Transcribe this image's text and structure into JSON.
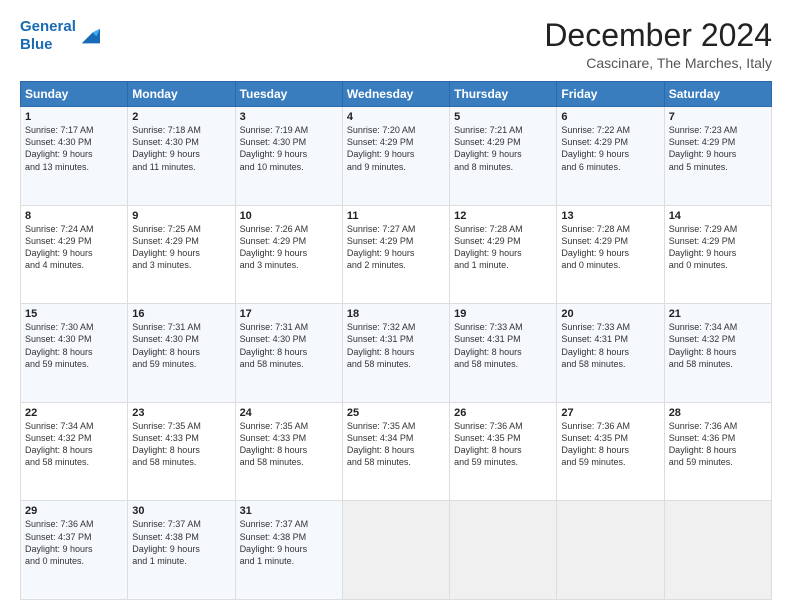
{
  "header": {
    "logo_line1": "General",
    "logo_line2": "Blue",
    "month": "December 2024",
    "location": "Cascinare, The Marches, Italy"
  },
  "days_of_week": [
    "Sunday",
    "Monday",
    "Tuesday",
    "Wednesday",
    "Thursday",
    "Friday",
    "Saturday"
  ],
  "weeks": [
    [
      {
        "day": "1",
        "lines": [
          "Sunrise: 7:17 AM",
          "Sunset: 4:30 PM",
          "Daylight: 9 hours",
          "and 13 minutes."
        ]
      },
      {
        "day": "2",
        "lines": [
          "Sunrise: 7:18 AM",
          "Sunset: 4:30 PM",
          "Daylight: 9 hours",
          "and 11 minutes."
        ]
      },
      {
        "day": "3",
        "lines": [
          "Sunrise: 7:19 AM",
          "Sunset: 4:30 PM",
          "Daylight: 9 hours",
          "and 10 minutes."
        ]
      },
      {
        "day": "4",
        "lines": [
          "Sunrise: 7:20 AM",
          "Sunset: 4:29 PM",
          "Daylight: 9 hours",
          "and 9 minutes."
        ]
      },
      {
        "day": "5",
        "lines": [
          "Sunrise: 7:21 AM",
          "Sunset: 4:29 PM",
          "Daylight: 9 hours",
          "and 8 minutes."
        ]
      },
      {
        "day": "6",
        "lines": [
          "Sunrise: 7:22 AM",
          "Sunset: 4:29 PM",
          "Daylight: 9 hours",
          "and 6 minutes."
        ]
      },
      {
        "day": "7",
        "lines": [
          "Sunrise: 7:23 AM",
          "Sunset: 4:29 PM",
          "Daylight: 9 hours",
          "and 5 minutes."
        ]
      }
    ],
    [
      {
        "day": "8",
        "lines": [
          "Sunrise: 7:24 AM",
          "Sunset: 4:29 PM",
          "Daylight: 9 hours",
          "and 4 minutes."
        ]
      },
      {
        "day": "9",
        "lines": [
          "Sunrise: 7:25 AM",
          "Sunset: 4:29 PM",
          "Daylight: 9 hours",
          "and 3 minutes."
        ]
      },
      {
        "day": "10",
        "lines": [
          "Sunrise: 7:26 AM",
          "Sunset: 4:29 PM",
          "Daylight: 9 hours",
          "and 3 minutes."
        ]
      },
      {
        "day": "11",
        "lines": [
          "Sunrise: 7:27 AM",
          "Sunset: 4:29 PM",
          "Daylight: 9 hours",
          "and 2 minutes."
        ]
      },
      {
        "day": "12",
        "lines": [
          "Sunrise: 7:28 AM",
          "Sunset: 4:29 PM",
          "Daylight: 9 hours",
          "and 1 minute."
        ]
      },
      {
        "day": "13",
        "lines": [
          "Sunrise: 7:28 AM",
          "Sunset: 4:29 PM",
          "Daylight: 9 hours",
          "and 0 minutes."
        ]
      },
      {
        "day": "14",
        "lines": [
          "Sunrise: 7:29 AM",
          "Sunset: 4:29 PM",
          "Daylight: 9 hours",
          "and 0 minutes."
        ]
      }
    ],
    [
      {
        "day": "15",
        "lines": [
          "Sunrise: 7:30 AM",
          "Sunset: 4:30 PM",
          "Daylight: 8 hours",
          "and 59 minutes."
        ]
      },
      {
        "day": "16",
        "lines": [
          "Sunrise: 7:31 AM",
          "Sunset: 4:30 PM",
          "Daylight: 8 hours",
          "and 59 minutes."
        ]
      },
      {
        "day": "17",
        "lines": [
          "Sunrise: 7:31 AM",
          "Sunset: 4:30 PM",
          "Daylight: 8 hours",
          "and 58 minutes."
        ]
      },
      {
        "day": "18",
        "lines": [
          "Sunrise: 7:32 AM",
          "Sunset: 4:31 PM",
          "Daylight: 8 hours",
          "and 58 minutes."
        ]
      },
      {
        "day": "19",
        "lines": [
          "Sunrise: 7:33 AM",
          "Sunset: 4:31 PM",
          "Daylight: 8 hours",
          "and 58 minutes."
        ]
      },
      {
        "day": "20",
        "lines": [
          "Sunrise: 7:33 AM",
          "Sunset: 4:31 PM",
          "Daylight: 8 hours",
          "and 58 minutes."
        ]
      },
      {
        "day": "21",
        "lines": [
          "Sunrise: 7:34 AM",
          "Sunset: 4:32 PM",
          "Daylight: 8 hours",
          "and 58 minutes."
        ]
      }
    ],
    [
      {
        "day": "22",
        "lines": [
          "Sunrise: 7:34 AM",
          "Sunset: 4:32 PM",
          "Daylight: 8 hours",
          "and 58 minutes."
        ]
      },
      {
        "day": "23",
        "lines": [
          "Sunrise: 7:35 AM",
          "Sunset: 4:33 PM",
          "Daylight: 8 hours",
          "and 58 minutes."
        ]
      },
      {
        "day": "24",
        "lines": [
          "Sunrise: 7:35 AM",
          "Sunset: 4:33 PM",
          "Daylight: 8 hours",
          "and 58 minutes."
        ]
      },
      {
        "day": "25",
        "lines": [
          "Sunrise: 7:35 AM",
          "Sunset: 4:34 PM",
          "Daylight: 8 hours",
          "and 58 minutes."
        ]
      },
      {
        "day": "26",
        "lines": [
          "Sunrise: 7:36 AM",
          "Sunset: 4:35 PM",
          "Daylight: 8 hours",
          "and 59 minutes."
        ]
      },
      {
        "day": "27",
        "lines": [
          "Sunrise: 7:36 AM",
          "Sunset: 4:35 PM",
          "Daylight: 8 hours",
          "and 59 minutes."
        ]
      },
      {
        "day": "28",
        "lines": [
          "Sunrise: 7:36 AM",
          "Sunset: 4:36 PM",
          "Daylight: 8 hours",
          "and 59 minutes."
        ]
      }
    ],
    [
      {
        "day": "29",
        "lines": [
          "Sunrise: 7:36 AM",
          "Sunset: 4:37 PM",
          "Daylight: 9 hours",
          "and 0 minutes."
        ]
      },
      {
        "day": "30",
        "lines": [
          "Sunrise: 7:37 AM",
          "Sunset: 4:38 PM",
          "Daylight: 9 hours",
          "and 1 minute."
        ]
      },
      {
        "day": "31",
        "lines": [
          "Sunrise: 7:37 AM",
          "Sunset: 4:38 PM",
          "Daylight: 9 hours",
          "and 1 minute."
        ]
      },
      {
        "day": "",
        "lines": []
      },
      {
        "day": "",
        "lines": []
      },
      {
        "day": "",
        "lines": []
      },
      {
        "day": "",
        "lines": []
      }
    ]
  ]
}
